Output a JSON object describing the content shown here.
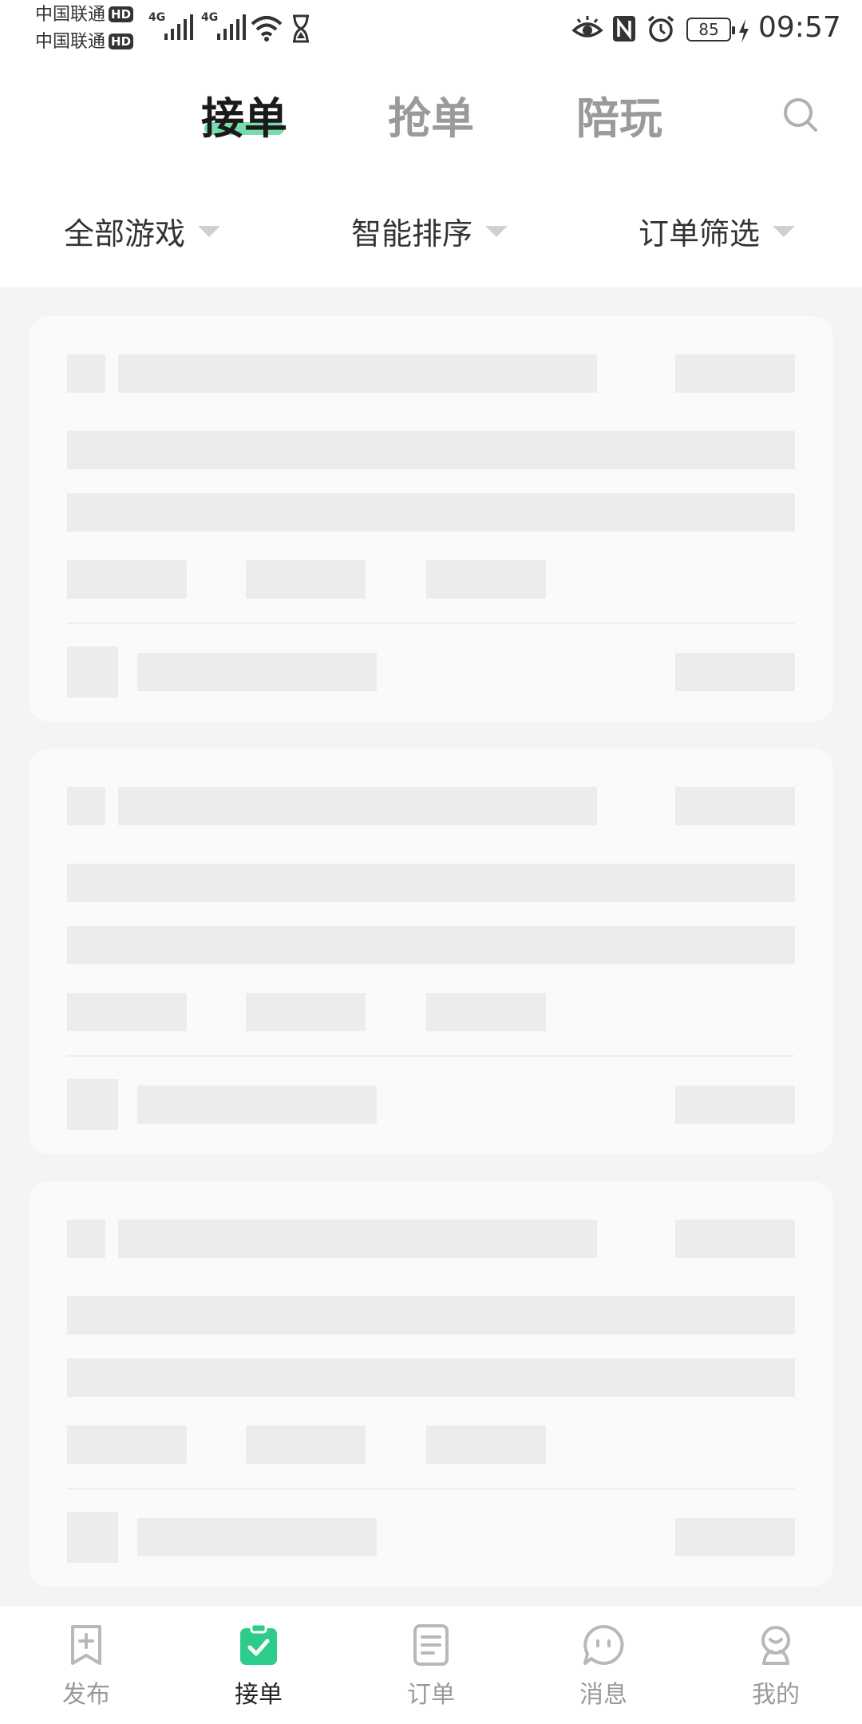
{
  "status_bar": {
    "carrier_1": "中国联通",
    "carrier_2": "中国联通",
    "hd_badge": "HD",
    "network_1": "4G",
    "network_2": "4G",
    "battery": "85",
    "time": "09:57"
  },
  "header": {
    "tabs": [
      {
        "label": "接单"
      },
      {
        "label": "抢单"
      },
      {
        "label": "陪玩"
      }
    ]
  },
  "filters": [
    {
      "label": "全部游戏"
    },
    {
      "label": "智能排序"
    },
    {
      "label": "订单筛选"
    }
  ],
  "bottom_nav": {
    "items": [
      {
        "label": "发布"
      },
      {
        "label": "接单"
      },
      {
        "label": "订单"
      },
      {
        "label": "消息"
      },
      {
        "label": "我的"
      }
    ]
  },
  "colors": {
    "accent": "#2ecc8a",
    "tab_underline": "#5fd5a0",
    "skeleton": "#ececec",
    "inactive_text": "#9a9a9a"
  }
}
